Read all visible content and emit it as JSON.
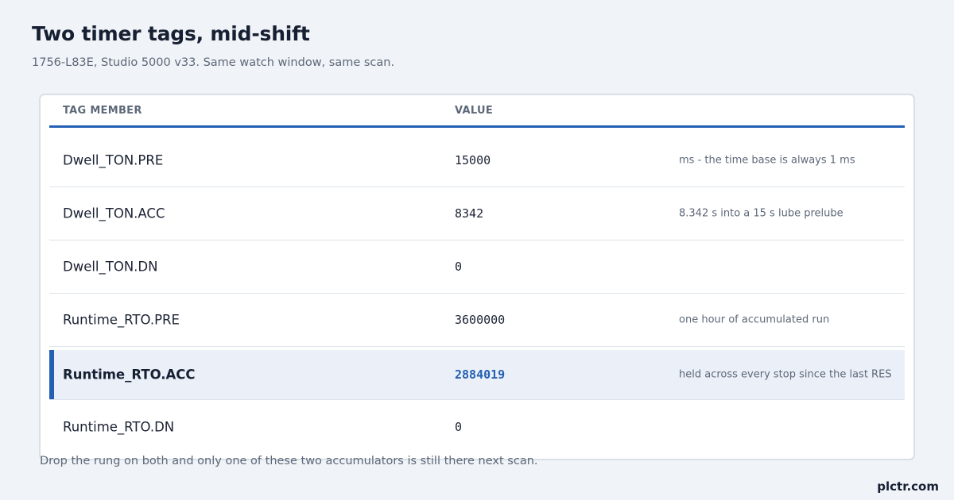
{
  "header": {
    "title": "Two timer tags, mid-shift",
    "subtitle": "1756-L83E, Studio 5000 v33. Same watch window, same scan."
  },
  "table": {
    "columns": {
      "member": "TAG MEMBER",
      "value": "VALUE"
    },
    "rows": [
      {
        "member": "Dwell_TON.PRE",
        "value": "15000",
        "note": "ms - the time base is always 1 ms",
        "highlight": false
      },
      {
        "member": "Dwell_TON.ACC",
        "value": "8342",
        "note": "8.342 s into a 15 s lube prelube",
        "highlight": false
      },
      {
        "member": "Dwell_TON.DN",
        "value": "0",
        "note": "",
        "highlight": false
      },
      {
        "member": "Runtime_RTO.PRE",
        "value": "3600000",
        "note": "one hour of accumulated run",
        "highlight": false
      },
      {
        "member": "Runtime_RTO.ACC",
        "value": "2884019",
        "note": "held across every stop since the last RES",
        "highlight": true
      },
      {
        "member": "Runtime_RTO.DN",
        "value": "0",
        "note": "",
        "highlight": false
      }
    ]
  },
  "footer": {
    "note": "Drop the rung on both and only one of these two accumulators is still there next scan.",
    "brand": "plctr.com"
  },
  "colors": {
    "accent": "#2360b3",
    "background": "#f0f3f7",
    "highlight_row": "#ebf0f8"
  }
}
